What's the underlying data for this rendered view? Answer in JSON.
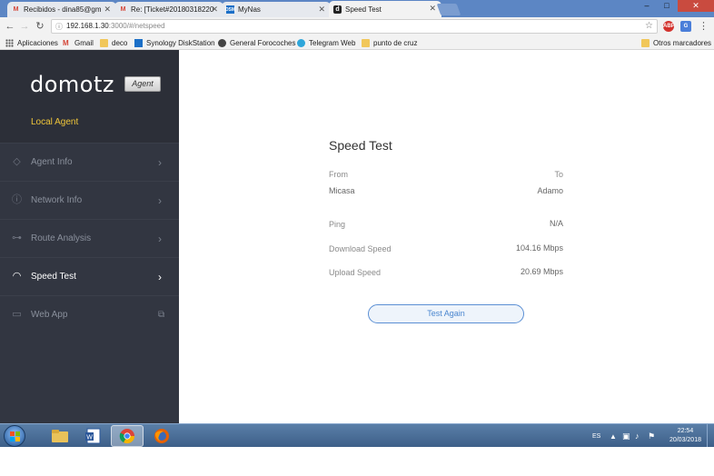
{
  "browser": {
    "tabs": [
      {
        "label": "Recibidos - dina85@gm",
        "icon": "gmail-icon"
      },
      {
        "label": "Re: [Ticket#20180318220",
        "icon": "gmail-icon"
      },
      {
        "label": "MyNas",
        "icon": "dsm-icon"
      },
      {
        "label": "Speed Test",
        "icon": "domotz-icon"
      }
    ],
    "window_controls": {
      "minimize": "–",
      "maximize": "□",
      "close": "✕"
    },
    "url_host": "192.168.1.30",
    "url_path": ":3000/#/netspeed",
    "bookmarks": [
      {
        "label": "Aplicaciones",
        "icon": "apps-grid-icon"
      },
      {
        "label": "Gmail",
        "icon": "gmail-icon"
      },
      {
        "label": "deco",
        "icon": "folder-icon"
      },
      {
        "label": "Synology DiskStation",
        "icon": "dsm-icon"
      },
      {
        "label": "General Forocoches",
        "icon": "forocoches-icon"
      },
      {
        "label": "Telegram Web",
        "icon": "telegram-icon"
      },
      {
        "label": "punto de cruz",
        "icon": "folder-icon"
      },
      {
        "label": "Otros marcadores",
        "icon": "folder-icon"
      }
    ],
    "extensions": [
      "ABP",
      "G"
    ]
  },
  "sidebar": {
    "logo": "domotz",
    "badge": "Agent",
    "subtitle": "Local Agent",
    "items": [
      {
        "label": "Agent Info",
        "icon": "agent-info-icon",
        "active": false
      },
      {
        "label": "Network Info",
        "icon": "info-circle-icon",
        "active": false
      },
      {
        "label": "Route Analysis",
        "icon": "route-icon",
        "active": false
      },
      {
        "label": "Speed Test",
        "icon": "gauge-icon",
        "active": true
      },
      {
        "label": "Web App",
        "icon": "laptop-icon",
        "active": false
      }
    ]
  },
  "speedtest": {
    "title": "Speed Test",
    "from_label": "From",
    "to_label": "To",
    "from_value": "Micasa",
    "to_value": "Adamo",
    "ping_label": "Ping",
    "ping_value": "N/A",
    "download_label": "Download Speed",
    "download_value": "104.16 Mbps",
    "upload_label": "Upload Speed",
    "upload_value": "20.69 Mbps",
    "button_label": "Test Again"
  },
  "taskbar": {
    "language": "ES",
    "time": "22:54",
    "date": "20/03/2018",
    "apps": [
      "explorer-icon",
      "word-icon",
      "chrome-icon",
      "firefox-icon"
    ]
  },
  "colors": {
    "sidebar_bg": "#323641",
    "accent_yellow": "#f0c63a",
    "button_blue": "#4a86cf",
    "tab_strip": "#5c86c4"
  }
}
